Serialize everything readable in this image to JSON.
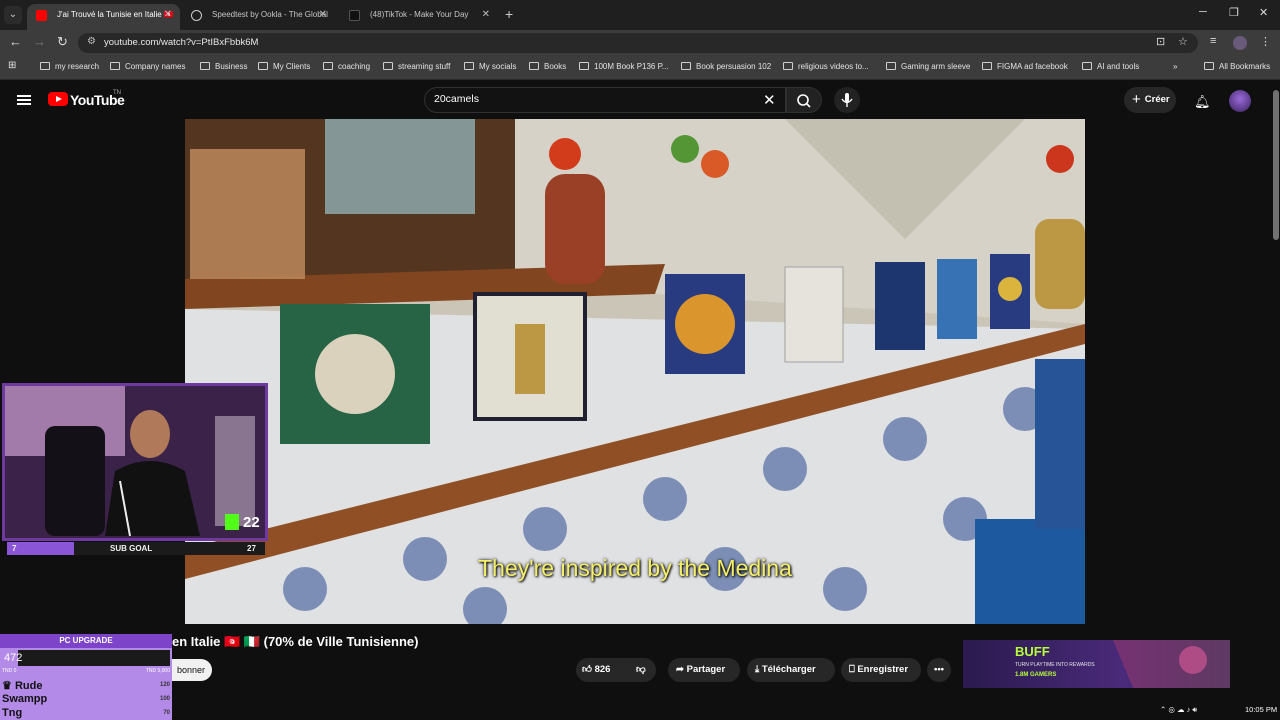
{
  "browser": {
    "tabs": [
      {
        "title": "J'ai Trouvé la Tunisie en Italie 🇹🇳",
        "active": true
      },
      {
        "title": "Speedtest by Ookla - The Global",
        "active": false
      },
      {
        "title": "(48)TikTok - Make Your Day",
        "active": false
      }
    ],
    "url": "youtube.com/watch?v=PtIBxFbbk6M",
    "bookmarks": [
      "my research",
      "Company names",
      "Business",
      "My Clients",
      "coaching",
      "streaming stuff",
      "My socials",
      "Books",
      "100M Book P136 P...",
      "Book persuasion 102",
      "religious videos to...",
      "Gaming arm sleeve",
      "FIGMA ad facebook",
      "AI and tools"
    ],
    "all_bookmarks": "All Bookmarks"
  },
  "youtube": {
    "logo_text": "YouTube",
    "country": "TN",
    "search_value": "20camels",
    "create_label": "Créer",
    "subtitle": "They're inspired by the Medina",
    "title": "en Italie 🇹🇳 🇮🇹 (70% de Ville Tunisienne)",
    "subscribe_label": "bonner",
    "likes": "826",
    "share_label": "Partager",
    "download_label": "Télécharger",
    "save_label": "Enregistrer"
  },
  "overlay": {
    "cam_count": "22",
    "subgoal_label": "SUB GOAL",
    "subgoal_current": "7",
    "subgoal_target": "27",
    "pc_header": "PC UPGRADE",
    "pc_amount": "472",
    "pc_min": "TND 0",
    "pc_max": "TND 5,000",
    "donors": [
      {
        "name": "Rude",
        "amount": "120"
      },
      {
        "name": "Swampp",
        "amount": "100"
      },
      {
        "name": "Tng",
        "amount": "70"
      }
    ]
  },
  "ad": {
    "brand": "BUFF",
    "tagline": "TURN PLAYTIME INTO REWARDS",
    "gamers": "1.8M GAMERS"
  },
  "taskbar": {
    "time": "10:05 PM"
  },
  "colors": {
    "accent_purple": "#8a55d6",
    "youtube_red": "#ff0000",
    "subtitle_yellow": "#f4ef6a"
  }
}
